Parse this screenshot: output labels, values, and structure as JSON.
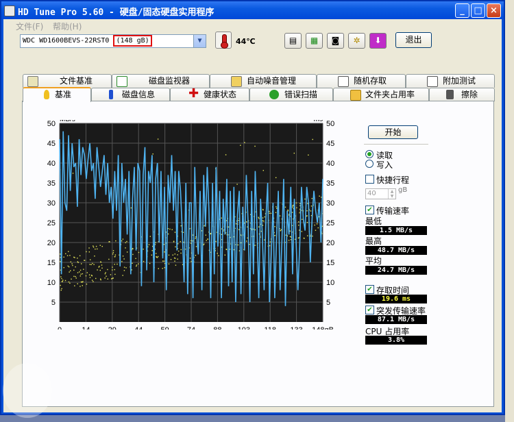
{
  "window": {
    "title": "HD Tune Pro 5.60 - 硬盘/固态硬盘实用程序",
    "minimize": "_",
    "maximize": "□",
    "close": "×"
  },
  "menu": {
    "file": "文件(F)",
    "help": "帮助(H)"
  },
  "toolbar": {
    "drive_model": "WDC WD1600BEVS-22RST0",
    "drive_size": "(148 gB)",
    "temperature": "44℃",
    "exit": "退出",
    "icons": [
      "copy-info-icon",
      "copy-screen-icon",
      "camera-icon",
      "settings-icon",
      "download-icon"
    ]
  },
  "tabs_top": [
    {
      "label": "文件基准",
      "icon": "file-benchmark-icon"
    },
    {
      "label": "磁盘监视器",
      "icon": "disk-monitor-icon"
    },
    {
      "label": "自动噪音管理",
      "icon": "speaker-icon"
    },
    {
      "label": "随机存取",
      "icon": "random-access-icon"
    },
    {
      "label": "附加测试",
      "icon": "extra-tests-icon"
    }
  ],
  "tabs_bottom": [
    {
      "label": "基准",
      "icon": "benchmark-icon"
    },
    {
      "label": "磁盘信息",
      "icon": "info-icon"
    },
    {
      "label": "健康状态",
      "icon": "health-cross-icon"
    },
    {
      "label": "错误扫描",
      "icon": "magnifier-icon"
    },
    {
      "label": "文件夹占用率",
      "icon": "folder-icon"
    },
    {
      "label": "擦除",
      "icon": "trash-icon"
    }
  ],
  "controls": {
    "start": "开始",
    "read": "读取",
    "write": "写入",
    "short_stroke": "快捷行程",
    "short_stroke_value": "40",
    "short_stroke_unit": "gB",
    "transfer_rate": "传输速率",
    "min_label": "最低",
    "min_value": "1.5 MB/s",
    "max_label": "最高",
    "max_value": "48.7 MB/s",
    "avg_label": "平均",
    "avg_value": "24.7 MB/s",
    "access_time": "存取时间",
    "access_time_value": "19.6 ms",
    "burst_rate": "突发传输速率",
    "burst_rate_value": "87.1 MB/s",
    "cpu_label": "CPU 占用率",
    "cpu_value": "3.8%"
  },
  "chart_data": {
    "type": "line",
    "ylabel_left": "MB/s",
    "ylabel_right": "ms",
    "x_ticks": [
      "0",
      "14",
      "29",
      "44",
      "59",
      "74",
      "88",
      "103",
      "118",
      "133",
      "148gB"
    ],
    "y_ticks": [
      "5",
      "10",
      "15",
      "20",
      "25",
      "30",
      "35",
      "40",
      "45",
      "50"
    ],
    "xlim": [
      0,
      148
    ],
    "ylim": [
      0,
      50
    ],
    "grid": true,
    "series": [
      {
        "color": "#4fb3f0",
        "x": [
          0,
          1,
          2,
          3,
          4,
          5,
          6,
          7,
          8,
          9,
          10,
          11,
          12,
          13,
          14,
          15,
          16,
          17,
          18,
          19,
          20,
          21,
          22,
          23,
          24,
          25,
          26,
          27,
          28,
          29,
          30,
          31,
          32,
          33,
          34,
          35,
          36,
          37,
          38,
          39,
          40,
          41,
          42,
          43,
          44,
          45,
          46,
          47,
          48,
          49,
          50,
          51,
          52,
          53,
          54,
          55,
          56,
          57,
          58,
          59,
          60,
          61,
          62,
          63,
          64,
          65,
          66,
          67,
          68,
          69,
          70,
          71,
          72,
          73,
          74,
          75,
          76,
          77,
          78,
          79,
          80,
          81,
          82,
          83,
          84,
          85,
          86,
          87,
          88,
          89,
          90,
          91,
          92,
          93,
          94,
          95,
          96,
          97,
          98,
          99,
          100,
          101,
          102,
          103,
          104,
          105,
          106,
          107,
          108,
          109,
          110,
          111,
          112,
          113,
          114,
          115,
          116,
          117,
          118,
          119,
          120,
          121,
          122,
          123,
          124,
          125,
          126,
          127,
          128,
          129,
          130,
          131,
          132,
          133,
          134,
          135,
          136,
          137,
          138,
          139,
          140,
          141,
          142,
          143,
          144,
          145,
          146,
          147,
          148
        ],
        "values": [
          46,
          12,
          48,
          30,
          28,
          47,
          33,
          45,
          39,
          40,
          29,
          46,
          37,
          44,
          42,
          36,
          41,
          45,
          38,
          40,
          31,
          44,
          39,
          34,
          38,
          42,
          32,
          40,
          30,
          34,
          26,
          38,
          28,
          42,
          14,
          40,
          30,
          36,
          22,
          38,
          12,
          31,
          39,
          18,
          40,
          38,
          9,
          37,
          44,
          13,
          38,
          35,
          42,
          10,
          36,
          40,
          20,
          38,
          16,
          34,
          8,
          37,
          30,
          42,
          28,
          38,
          18,
          38,
          33,
          23,
          10,
          35,
          7,
          30,
          30,
          6,
          39,
          22,
          17,
          33,
          8,
          37,
          24,
          39,
          28,
          6,
          35,
          12,
          39,
          19,
          33,
          6,
          31,
          22,
          36,
          9,
          33,
          10,
          34,
          5,
          27,
          33,
          7,
          29,
          18,
          37,
          25,
          5,
          33,
          12,
          38,
          24,
          6,
          31,
          22,
          8,
          26,
          35,
          5,
          17,
          30,
          6,
          21,
          33,
          8,
          20,
          36,
          4,
          28,
          22,
          34,
          12,
          31,
          20,
          8,
          19,
          34,
          26,
          23,
          34,
          30,
          15,
          26,
          33,
          28,
          25,
          30,
          20,
          36
        ]
      }
    ],
    "scatter": {
      "color": "#e8e85a",
      "note": "access time (ms), yellow dots increasing from ~13 to ~27 ms"
    }
  }
}
